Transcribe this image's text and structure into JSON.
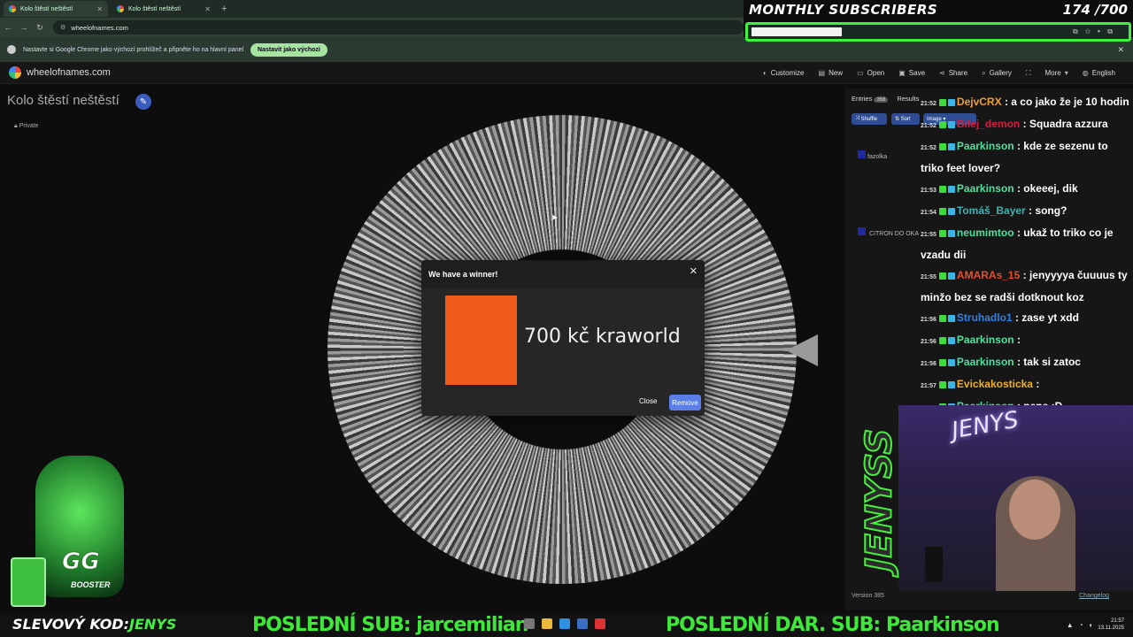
{
  "browser": {
    "tabs": [
      {
        "label": "Kolo štěstí neštěstí",
        "active": true
      },
      {
        "label": "Kolo štěstí neštěstí",
        "active": false
      }
    ],
    "url": "wheelofnames.com",
    "infobar_text": "Nastavte si Google Chrome jako výchozí prohlížeč a připněte ho na hlavní panel",
    "infobar_button": "Nastavit jako výchozí"
  },
  "subs_overlay": {
    "title": "MONTHLY SUBSCRIBERS",
    "count": "174 /700",
    "progress": 0.25,
    "accent": "#3cf23a"
  },
  "app": {
    "site": "wheelofnames.com",
    "menu": [
      {
        "label": "Customize",
        "icon": "palette-icon"
      },
      {
        "label": "New",
        "icon": "file-icon"
      },
      {
        "label": "Open",
        "icon": "folder-icon"
      },
      {
        "label": "Save",
        "icon": "save-icon"
      },
      {
        "label": "Share",
        "icon": "share-icon"
      },
      {
        "label": "Gallery",
        "icon": "search-icon"
      },
      {
        "label": "",
        "icon": "fullscreen-icon"
      },
      {
        "label": "More",
        "icon": "chevron-down-icon"
      },
      {
        "label": "English",
        "icon": "globe-icon"
      }
    ],
    "wheel_title": "Kolo štěstí neštěstí",
    "visibility": "Private"
  },
  "dialog": {
    "title": "We have a winner!",
    "winner": "700 kč kraworld",
    "winner_color": "#f05a1a",
    "close_label": "Close",
    "remove_label": "Remove"
  },
  "panel": {
    "tab_entries": "Entries",
    "entries_count": "358",
    "tab_results": "Results",
    "shuffle": "Shuffle",
    "sort": "Sort",
    "image": "Image",
    "entries": [
      "fazolka",
      "CITRON DO OKA"
    ],
    "version": "Version 385",
    "changelog": "Changelog"
  },
  "chat": [
    {
      "time": "21:52",
      "user": "DejvCRX",
      "color": "#f0a030",
      "text": ": a co jako že je 10 hodin"
    },
    {
      "time": "21:52",
      "user": "Bilej_demon",
      "color": "#d02040",
      "text": ": Squadra azzura"
    },
    {
      "time": "21:52",
      "user": "Paarkinson",
      "color": "#50e0a0",
      "text": ": kde ze sezenu to triko feet lover?"
    },
    {
      "time": "21:53",
      "user": "Paarkinson",
      "color": "#50e0a0",
      "text": ": okeeej, dik"
    },
    {
      "time": "21:54",
      "user": "Tomáš_Bayer",
      "color": "#40b0b0",
      "text": ": song?"
    },
    {
      "time": "21:55",
      "user": "neumimtoo",
      "color": "#50e0a0",
      "text": ": ukaž to triko co je vzadu dii"
    },
    {
      "time": "21:55",
      "user": "AMARAs_15",
      "color": "#e05030",
      "text": ": jenyyyya čuuuus ty minžo bez se radši dotknout koz"
    },
    {
      "time": "21:56",
      "user": "Struhadlo1",
      "color": "#3080e0",
      "text": ": zase yt xdd"
    },
    {
      "time": "21:56",
      "user": "Paarkinson",
      "color": "#50e0a0",
      "text": ":"
    },
    {
      "time": "21:56",
      "user": "Paarkinson",
      "color": "#50e0a0",
      "text": ": tak si zatoc"
    },
    {
      "time": "21:57",
      "user": "Evickakosticka",
      "color": "#f0b020",
      "text": ":"
    },
    {
      "time": "21:57",
      "user": "Paarkinson",
      "color": "#50e0a0",
      "text": ": nene :D"
    }
  ],
  "overlay": {
    "promo_prefix": "SLEVOVÝ KOD:",
    "promo_code": "JENYS",
    "last_sub": "POSLEDNÍ SUB: jarcemilian",
    "last_gift": "POSLEDNÍ DAR. SUB: Paarkinson",
    "webcam_neon": "JENYS",
    "vertical_brand": "JENYSS",
    "mascot_text": "GG",
    "mascot_sub": "BOOSTER"
  },
  "taskbar": {
    "time": "21:57",
    "date": "13.11.2025"
  }
}
